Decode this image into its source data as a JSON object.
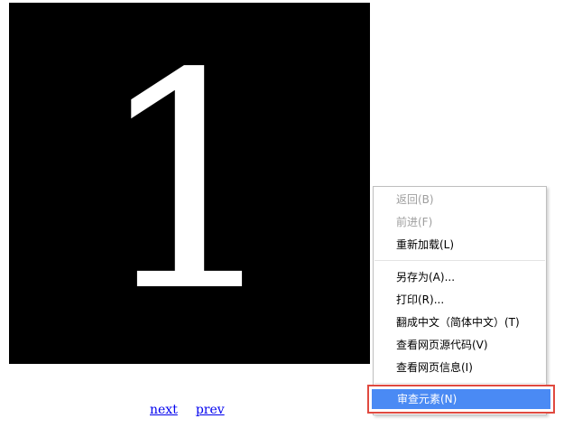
{
  "slide": {
    "number": "1"
  },
  "nav": {
    "next_label": "next",
    "prev_label": "prev"
  },
  "context_menu": {
    "items": [
      {
        "label": "返回(B)",
        "enabled": false
      },
      {
        "label": "前进(F)",
        "enabled": false
      },
      {
        "label": "重新加载(L)",
        "enabled": true
      },
      {
        "label": "另存为(A)...",
        "enabled": true
      },
      {
        "label": "打印(R)...",
        "enabled": true
      },
      {
        "label": "翻成中文（简体中文）(T)",
        "enabled": true
      },
      {
        "label": "查看网页源代码(V)",
        "enabled": true
      },
      {
        "label": "查看网页信息(I)",
        "enabled": true
      },
      {
        "label": "审查元素(N)",
        "enabled": true,
        "highlighted": true
      }
    ]
  },
  "colors": {
    "slide_background": "#000000",
    "slide_text": "#ffffff",
    "link": "#0000ee",
    "menu_highlight": "#4a8af4",
    "annotation_border": "#e0493f"
  }
}
